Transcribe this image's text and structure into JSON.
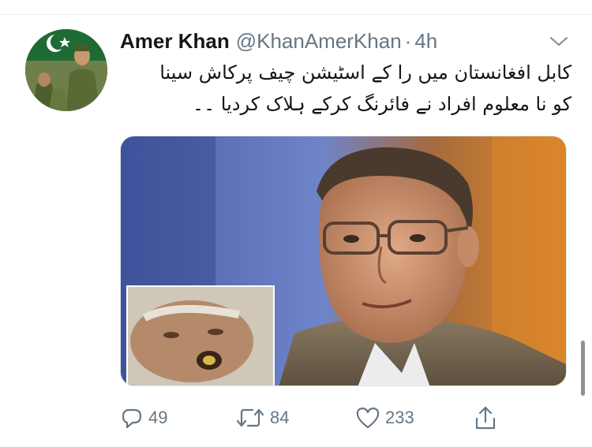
{
  "tweet": {
    "author": {
      "display_name": "Amer Khan",
      "handle": "@KhanAmerKhan",
      "avatar_icon": "avatar-image"
    },
    "separator": "·",
    "time": "4h",
    "text_lines": [
      "کابل افغانستان میں را کے اسٹیشن چیف پرکاش سینا",
      "کو نا معلوم افراد نے فائرنگ کرکے ہلاک کردیا ۔۔"
    ],
    "actions": {
      "reply": {
        "icon": "reply-icon",
        "count": "49"
      },
      "retweet": {
        "icon": "retweet-icon",
        "count": "84"
      },
      "like": {
        "icon": "heart-icon",
        "count": "233"
      },
      "share": {
        "icon": "share-icon"
      }
    },
    "menu_icon": "chevron-down-icon"
  },
  "colors": {
    "text_primary": "#14171a",
    "text_secondary": "#657786",
    "divider": "#e1e8ed"
  }
}
